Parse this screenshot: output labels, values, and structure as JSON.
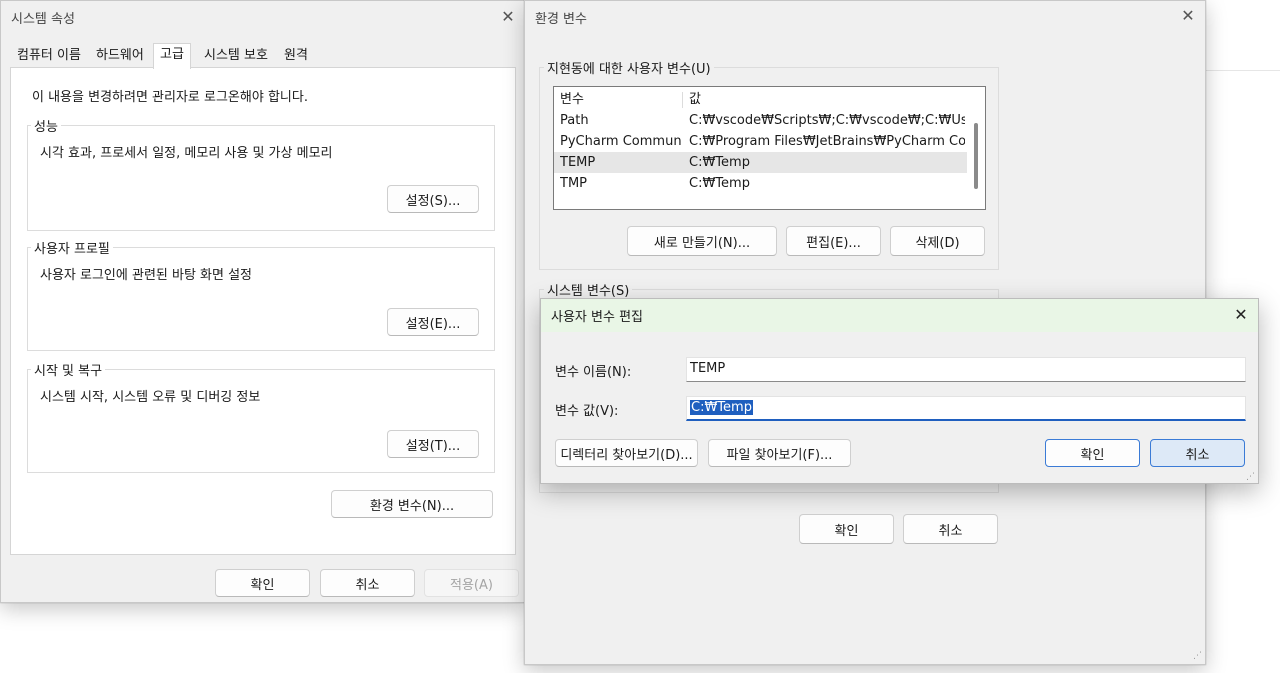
{
  "system_properties": {
    "title": "시스템 속성",
    "tabs": [
      "컴퓨터 이름",
      "하드웨어",
      "고급",
      "시스템 보호",
      "원격"
    ],
    "admin_note": "이 내용을 변경하려면 관리자로 로그온해야 합니다.",
    "performance": {
      "label": "성능",
      "desc": "시각 효과, 프로세서 일정, 메모리 사용 및 가상 메모리",
      "button": "설정(S)..."
    },
    "user_profile": {
      "label": "사용자 프로필",
      "desc": "사용자 로그인에 관련된 바탕 화면 설정",
      "button": "설정(E)..."
    },
    "startup": {
      "label": "시작 및 복구",
      "desc": "시스템 시작, 시스템 오류 및 디버깅 정보",
      "button": "설정(T)..."
    },
    "env_button": "환경 변수(N)...",
    "ok": "확인",
    "cancel": "취소",
    "apply": "적용(A)"
  },
  "env_vars": {
    "title": "환경 변수",
    "user_group_label": "지현동에 대한 사용자 변수(U)",
    "columns": [
      "변수",
      "값"
    ],
    "rows": [
      [
        "Path",
        "C:₩vscode₩Scripts₩;C:₩vscode₩;C:₩Users₩..."
      ],
      [
        "PyCharm Communi...",
        "C:₩Program Files₩JetBrains₩PyCharm Comm..."
      ],
      [
        "TEMP",
        "C:₩Temp"
      ],
      [
        "TMP",
        "C:₩Temp"
      ]
    ],
    "new_button": "새로 만들기(N)...",
    "edit_button": "편집(E)...",
    "delete_button": "삭제(D)",
    "system_group_label": "시스템 변수(S)",
    "ok": "확인",
    "cancel": "취소"
  },
  "edit_dialog": {
    "title": "사용자 변수 편집",
    "name_label": "변수 이름(N):",
    "name_value": "TEMP",
    "value_label": "변수 값(V):",
    "value_value": "C:₩Temp",
    "browse_dir": "디렉터리 찾아보기(D)...",
    "browse_file": "파일 찾아보기(F)...",
    "ok": "확인",
    "cancel": "취소"
  },
  "colors": {
    "dialog_title_bg": "#e9f6e6",
    "accent": "#1f5fbf",
    "window_bg": "#f0f0f0"
  }
}
